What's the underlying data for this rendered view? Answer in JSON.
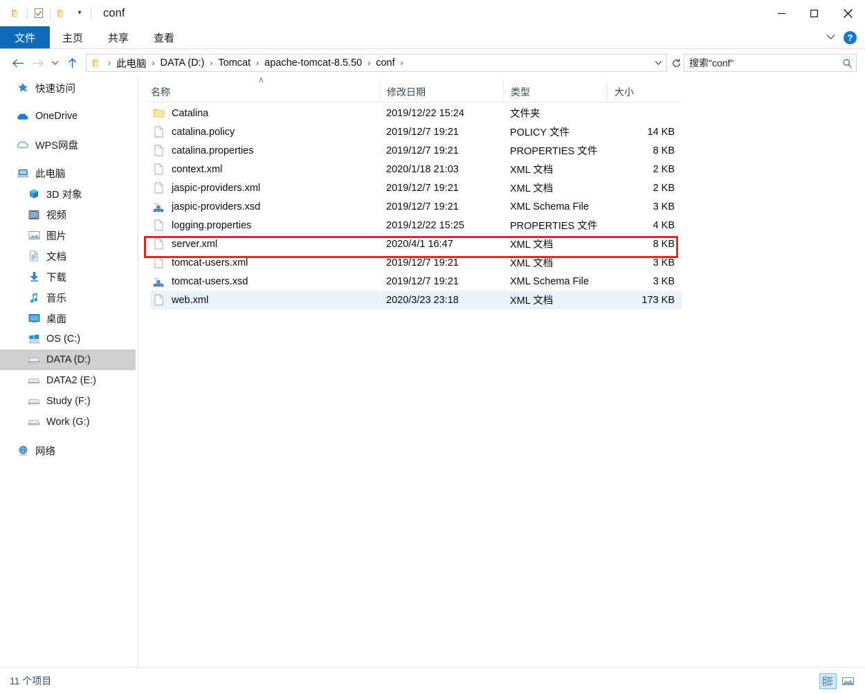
{
  "window": {
    "title": "conf",
    "quick_access": [
      {
        "icon": "folder-icon",
        "name": "qat-folder-icon"
      },
      {
        "icon": "properties-checkbox-icon",
        "name": "qat-properties-icon"
      },
      {
        "icon": "new-folder-icon",
        "name": "qat-new-folder-icon"
      },
      {
        "icon": "chevron-down-icon",
        "name": "qat-customize-icon"
      }
    ],
    "controls": {
      "minimize": "–",
      "maximize": "□",
      "close": "✕"
    }
  },
  "ribbon": {
    "tabs": [
      {
        "label": "文件",
        "name": "tab-file",
        "active": true
      },
      {
        "label": "主页",
        "name": "tab-home",
        "active": false
      },
      {
        "label": "共享",
        "name": "tab-share",
        "active": false
      },
      {
        "label": "查看",
        "name": "tab-view",
        "active": false
      }
    ],
    "collapse_icon": "chevron-down-icon",
    "help_label": "?"
  },
  "addressbar": {
    "back_icon": "arrow-left-icon",
    "forward_icon": "arrow-right-icon",
    "history_icon": "chevron-down-icon",
    "up_icon": "arrow-up-icon",
    "refresh_icon": "refresh-icon",
    "dropdown_icon": "chevron-down-icon",
    "breadcrumbs": [
      "此电脑",
      "DATA (D:)",
      "Tomcat",
      "apache-tomcat-8.5.50",
      "conf"
    ],
    "separator": "›"
  },
  "search": {
    "placeholder": "搜索\"conf\"",
    "value": "",
    "icon": "search-icon"
  },
  "sidebar": {
    "items": [
      {
        "label": "快速访问",
        "icon": "star-pin-icon",
        "level": 0,
        "selected": false,
        "gap_before": false
      },
      {
        "label": "OneDrive",
        "icon": "onedrive-cloud-icon",
        "level": 0,
        "selected": false,
        "gap_before": true
      },
      {
        "label": "WPS网盘",
        "icon": "wps-cloud-icon",
        "level": 0,
        "selected": false,
        "gap_before": true
      },
      {
        "label": "此电脑",
        "icon": "this-pc-icon",
        "level": 0,
        "selected": false,
        "gap_before": true
      },
      {
        "label": "3D 对象",
        "icon": "3d-objects-icon",
        "level": 1,
        "selected": false,
        "gap_before": false
      },
      {
        "label": "视频",
        "icon": "videos-icon",
        "level": 1,
        "selected": false,
        "gap_before": false
      },
      {
        "label": "图片",
        "icon": "pictures-icon",
        "level": 1,
        "selected": false,
        "gap_before": false
      },
      {
        "label": "文档",
        "icon": "documents-icon",
        "level": 1,
        "selected": false,
        "gap_before": false
      },
      {
        "label": "下载",
        "icon": "downloads-icon",
        "level": 1,
        "selected": false,
        "gap_before": false
      },
      {
        "label": "音乐",
        "icon": "music-icon",
        "level": 1,
        "selected": false,
        "gap_before": false
      },
      {
        "label": "桌面",
        "icon": "desktop-icon",
        "level": 1,
        "selected": false,
        "gap_before": false
      },
      {
        "label": "OS (C:)",
        "icon": "windows-drive-icon",
        "level": 1,
        "selected": false,
        "gap_before": false
      },
      {
        "label": "DATA (D:)",
        "icon": "drive-icon",
        "level": 1,
        "selected": true,
        "gap_before": false
      },
      {
        "label": "DATA2 (E:)",
        "icon": "drive-icon",
        "level": 1,
        "selected": false,
        "gap_before": false
      },
      {
        "label": "Study (F:)",
        "icon": "drive-icon",
        "level": 1,
        "selected": false,
        "gap_before": false
      },
      {
        "label": "Work (G:)",
        "icon": "drive-icon",
        "level": 1,
        "selected": false,
        "gap_before": false
      },
      {
        "label": "网络",
        "icon": "network-icon",
        "level": 0,
        "selected": false,
        "gap_before": true
      }
    ]
  },
  "filelist": {
    "columns": [
      {
        "label": "名称",
        "name": "column-header-name",
        "sorted": true,
        "sort_caret": "∧"
      },
      {
        "label": "修改日期",
        "name": "column-header-date",
        "sorted": false,
        "sort_caret": ""
      },
      {
        "label": "类型",
        "name": "column-header-type",
        "sorted": false,
        "sort_caret": ""
      },
      {
        "label": "大小",
        "name": "column-header-size",
        "sorted": false,
        "sort_caret": ""
      }
    ],
    "rows": [
      {
        "name": "Catalina",
        "date": "2019/12/22 15:24",
        "type": "文件夹",
        "size": "",
        "icon": "folder-icon",
        "selected": false,
        "highlighted": false
      },
      {
        "name": "catalina.policy",
        "date": "2019/12/7 19:21",
        "type": "POLICY 文件",
        "size": "14 KB",
        "icon": "generic-file-icon",
        "selected": false,
        "highlighted": false
      },
      {
        "name": "catalina.properties",
        "date": "2019/12/7 19:21",
        "type": "PROPERTIES 文件",
        "size": "8 KB",
        "icon": "generic-file-icon",
        "selected": false,
        "highlighted": false
      },
      {
        "name": "context.xml",
        "date": "2020/1/18 21:03",
        "type": "XML 文档",
        "size": "2 KB",
        "icon": "generic-file-icon",
        "selected": false,
        "highlighted": false
      },
      {
        "name": "jaspic-providers.xml",
        "date": "2019/12/7 19:21",
        "type": "XML 文档",
        "size": "2 KB",
        "icon": "generic-file-icon",
        "selected": false,
        "highlighted": false
      },
      {
        "name": "jaspic-providers.xsd",
        "date": "2019/12/7 19:21",
        "type": "XML Schema File",
        "size": "3 KB",
        "icon": "xsd-schema-icon",
        "selected": false,
        "highlighted": false
      },
      {
        "name": "logging.properties",
        "date": "2019/12/22 15:25",
        "type": "PROPERTIES 文件",
        "size": "4 KB",
        "icon": "generic-file-icon",
        "selected": false,
        "highlighted": false
      },
      {
        "name": "server.xml",
        "date": "2020/4/1 16:47",
        "type": "XML 文档",
        "size": "8 KB",
        "icon": "generic-file-icon",
        "selected": false,
        "highlighted": true
      },
      {
        "name": "tomcat-users.xml",
        "date": "2019/12/7 19:21",
        "type": "XML 文档",
        "size": "3 KB",
        "icon": "generic-file-icon",
        "selected": false,
        "highlighted": false
      },
      {
        "name": "tomcat-users.xsd",
        "date": "2019/12/7 19:21",
        "type": "XML Schema File",
        "size": "3 KB",
        "icon": "xsd-schema-icon",
        "selected": false,
        "highlighted": false
      },
      {
        "name": "web.xml",
        "date": "2020/3/23 23:18",
        "type": "XML 文档",
        "size": "173 KB",
        "icon": "generic-file-icon",
        "selected": true,
        "highlighted": false
      }
    ]
  },
  "statusbar": {
    "item_count": "11 个项目",
    "views": [
      {
        "name": "details-view-button",
        "icon": "details-view-icon",
        "active": true
      },
      {
        "name": "large-icons-view-button",
        "icon": "large-icons-view-icon",
        "active": false
      }
    ]
  },
  "colors": {
    "accent": "#0d6bb8",
    "highlight_box": "#ee2222",
    "selection": "#e8f2fb",
    "sidebar_selection": "#cfcfcf"
  }
}
